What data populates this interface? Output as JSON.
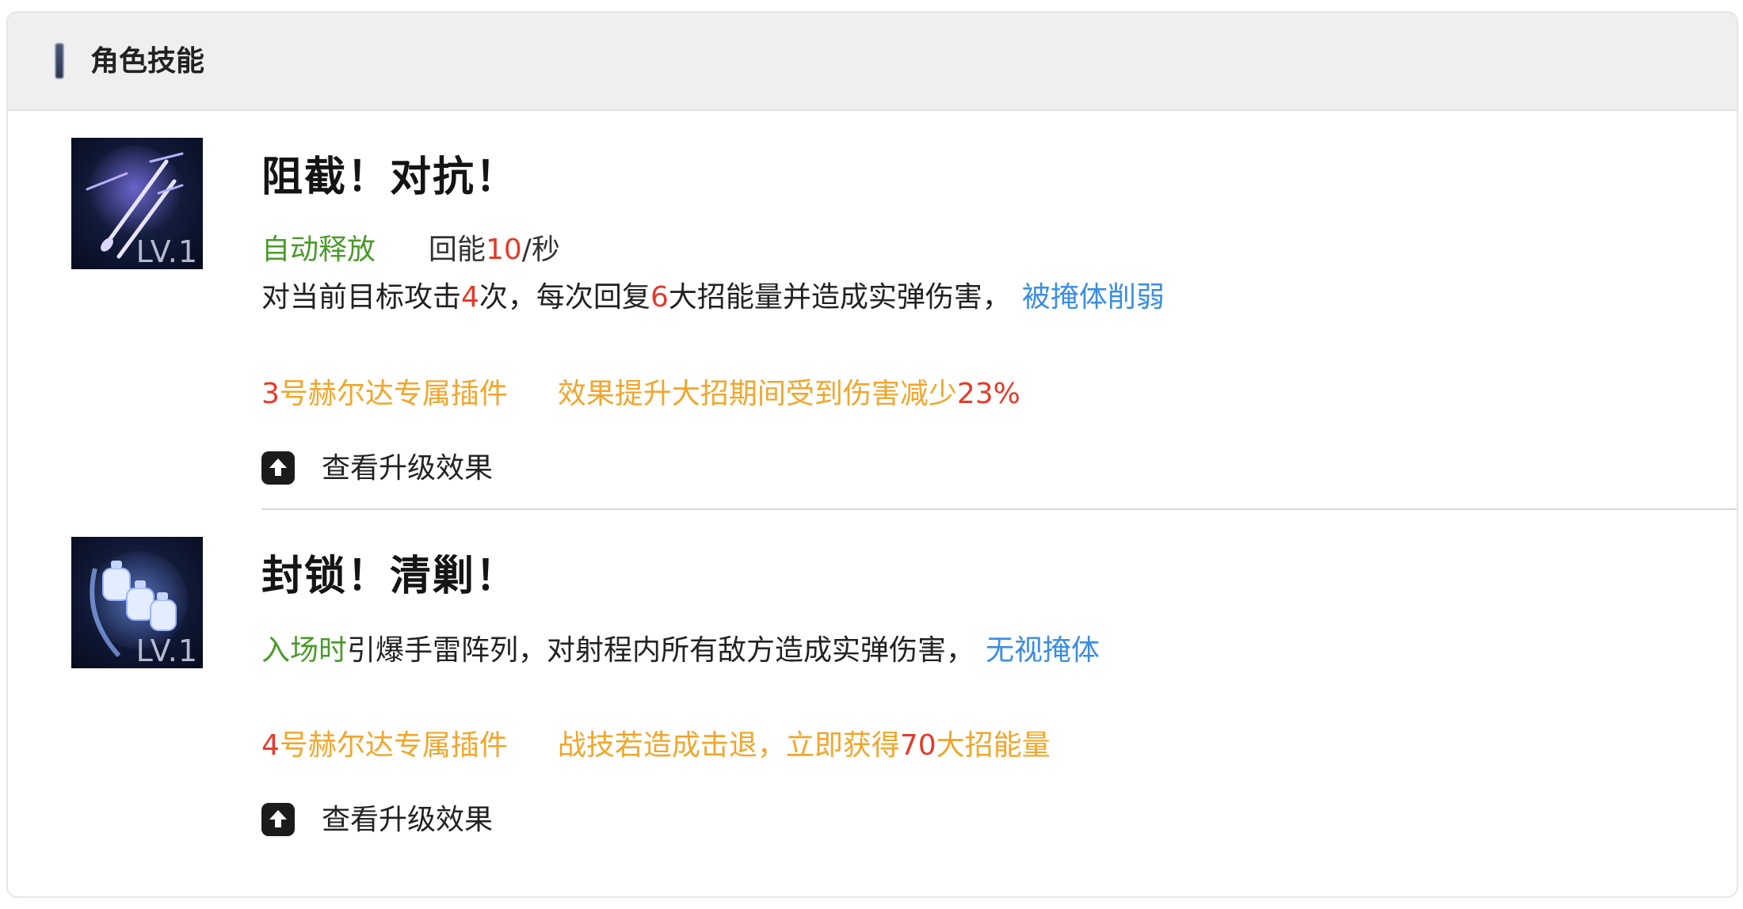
{
  "header": {
    "title": "角色技能"
  },
  "skills": [
    {
      "name": "阻截！对抗！",
      "icon": "bullet-strike-icon",
      "level": "LV.1",
      "trigger": "自动释放",
      "energy_prefix": "回能",
      "energy_value": "10",
      "energy_suffix": "/秒",
      "desc_1": "对当前目标攻击",
      "desc_hits": "4",
      "desc_2": "次，每次回复",
      "desc_energy": "6",
      "desc_3": "大招能量并造成实弹伤害，",
      "desc_tag": "被掩体削弱",
      "plugin_num": "3",
      "plugin_name": "号赫尔达专属插件",
      "plugin_effect": "效果提升大招期间受到伤害减少",
      "plugin_value": "23%",
      "upgrade_label": "查看升级效果"
    },
    {
      "name": "封锁！清剿！",
      "icon": "grenade-array-icon",
      "level": "LV.1",
      "trigger": "入场时",
      "desc_1": "引爆手雷阵列，对射程内所有敌方造成实弹伤害，",
      "desc_tag": "无视掩体",
      "plugin_num": "4",
      "plugin_name": "号赫尔达专属插件",
      "plugin_effect_1": "战技若造成击退，立即获得",
      "plugin_value": "70",
      "plugin_effect_2": "大招能量",
      "upgrade_label": "查看升级效果"
    }
  ],
  "colors": {
    "trigger": "#4a9a2a",
    "number": "#e53a2a",
    "tag": "#3a8ee0",
    "plugin_effect": "#f2a52a"
  }
}
